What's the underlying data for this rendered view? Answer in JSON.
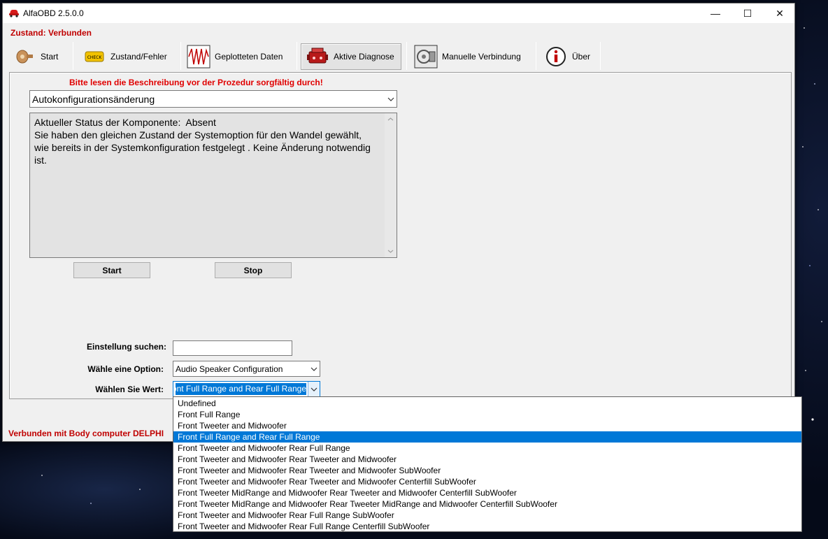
{
  "window": {
    "title": "AlfaOBD 2.5.0.0",
    "controls": {
      "minimize": "—",
      "maximize": "☐",
      "close": "✕"
    }
  },
  "status_top": "Zustand: Verbunden",
  "toolbar": {
    "items": [
      {
        "label": "Start",
        "icon": "ignition-key-icon"
      },
      {
        "label": "Zustand/Fehler",
        "icon": "check-engine-icon"
      },
      {
        "label": "Geplotteten Daten",
        "icon": "waveform-plot-icon"
      },
      {
        "label": "Aktive Diagnose",
        "icon": "engine-icon",
        "active": true
      },
      {
        "label": "Manuelle Verbindung",
        "icon": "manual-connection-icon"
      },
      {
        "label": "Über",
        "icon": "info-icon"
      }
    ]
  },
  "main": {
    "warning": "Bitte lesen die Beschreibung vor der Prozedur sorgfältig durch!",
    "procedure": "Autokonfigurationsänderung",
    "status_text": "Aktueller Status der Komponente:  Absent\nSie haben den gleichen Zustand der Systemoption für den Wandel gewählt, wie bereits in der Systemkonfiguration festgelegt . Keine Änderung notwendig ist.",
    "start_label": "Start",
    "stop_label": "Stop",
    "search_label": "Einstellung suchen:",
    "search_value": "",
    "option_label": "Wähle eine Option:",
    "option_value": "Audio Speaker Configuration",
    "value_label": "Wählen Sie Wert:",
    "value_selected": "Front Full Range and Rear Full Range"
  },
  "status_bottom": "Verbunden mit Body computer DELPHI",
  "dropdown": {
    "selected_index": 3,
    "options": [
      "Undefined",
      "Front Full Range",
      "Front Tweeter and Midwoofer",
      "Front Full Range and Rear Full Range",
      "Front Tweeter and Midwoofer Rear Full Range",
      "Front Tweeter and Midwoofer Rear Tweeter and Midwoofer",
      "Front Tweeter and Midwoofer Rear Tweeter and Midwoofer SubWoofer",
      "Front Tweeter and Midwoofer Rear Tweeter and Midwoofer Centerfill SubWoofer",
      "Front Tweeter MidRange and Midwoofer Rear Tweeter and Midwoofer Centerfill SubWoofer",
      "Front Tweeter MidRange and Midwoofer Rear Tweeter MidRange and Midwoofer Centerfill SubWoofer",
      "Front Tweeter and Midwoofer Rear Full Range SubWoofer",
      "Front Tweeter and Midwoofer Rear Full Range Centerfill SubWoofer"
    ]
  },
  "colors": {
    "status_red": "#c00000",
    "warning_red": "#e00000",
    "selection_blue": "#0078d7"
  }
}
